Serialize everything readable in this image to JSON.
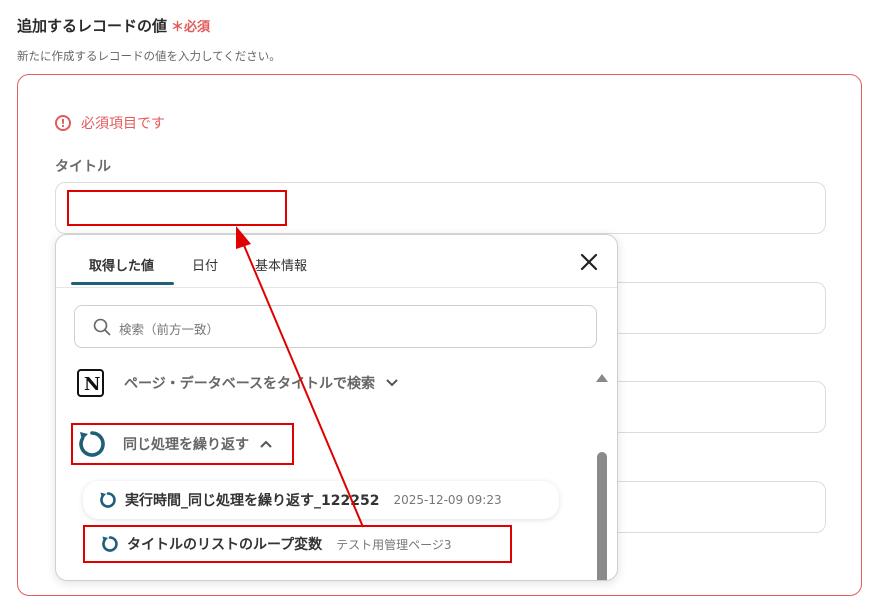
{
  "section": {
    "title": "追加するレコードの値",
    "required_mark": "＊必須",
    "description": "新たに作成するレコードの値を入力してください。"
  },
  "error": {
    "icon": "alert-circle-icon",
    "text": "必須項目です"
  },
  "field": {
    "label": "タイトル",
    "value": ""
  },
  "panel": {
    "tabs": [
      {
        "label": "取得した値",
        "active": true
      },
      {
        "label": "日付",
        "active": false
      },
      {
        "label": "基本情報",
        "active": false
      }
    ],
    "close_icon": "close-icon",
    "search_placeholder": "検索（前方一致）",
    "groups": [
      {
        "label": "ページ・データベースをタイトルで検索",
        "icon": "notion-icon",
        "expanded": false
      },
      {
        "label": "同じ処理を繰り返す",
        "icon": "loop-icon",
        "expanded": true
      }
    ],
    "items": [
      {
        "name": "実行時間_同じ処理を繰り返す_122252",
        "sub": "2025-12-09 09:23"
      },
      {
        "name": "タイトルのリストのループ変数",
        "sub": "テスト用管理ページ3"
      }
    ]
  },
  "colors": {
    "error": "#e25a5a",
    "accent": "#1f5f7a",
    "highlight": "#e00000"
  }
}
